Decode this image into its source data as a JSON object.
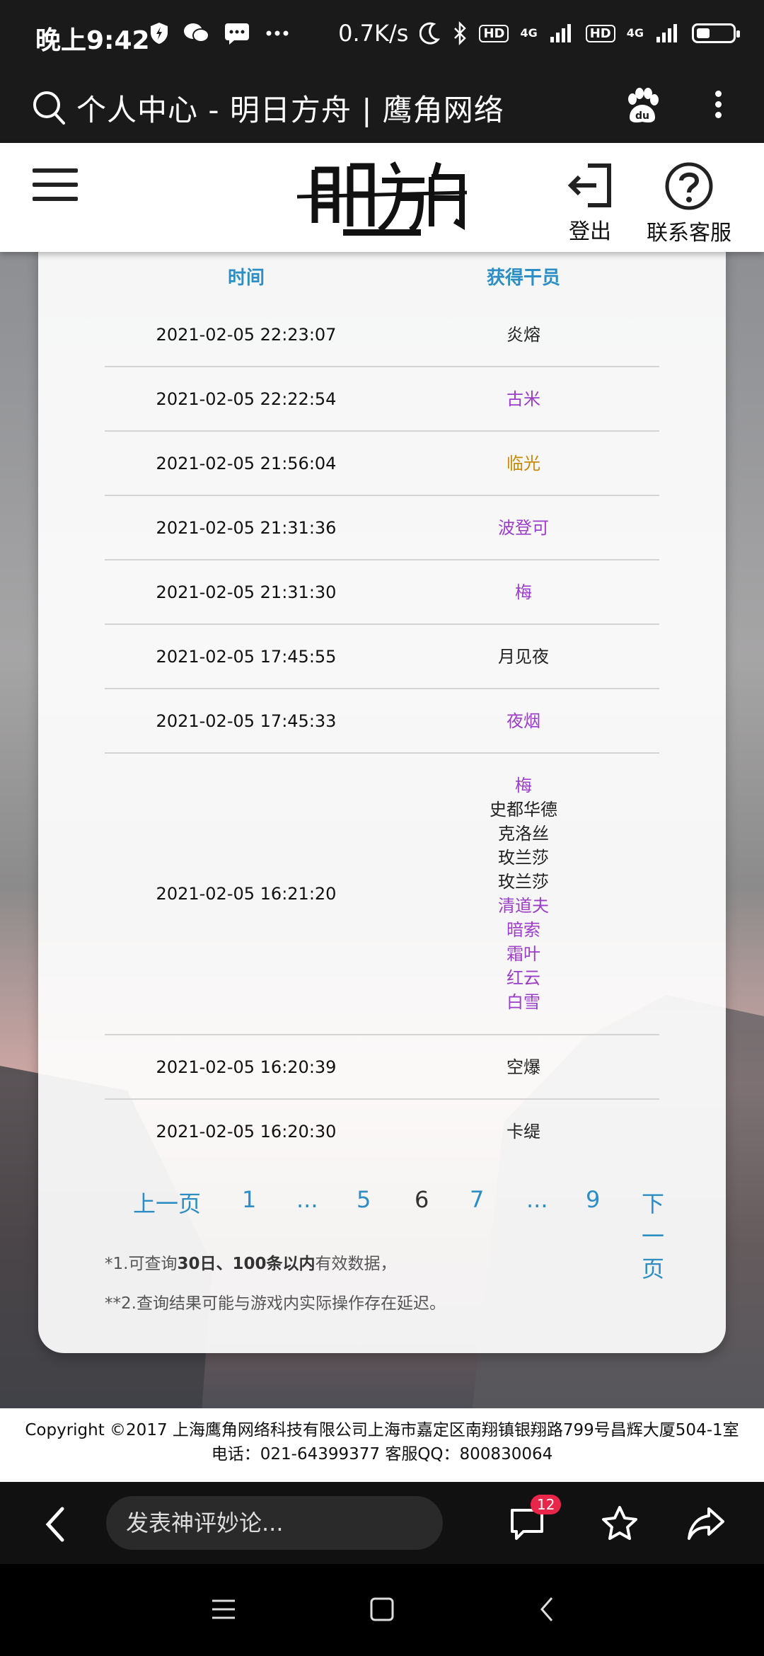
{
  "status_bar": {
    "time": "晚上9:42",
    "speed": "0.7K/s",
    "net1": "4G",
    "net2": "4G",
    "hd1": "HD",
    "hd2": "HD",
    "battery_level": 0.35
  },
  "browser": {
    "title": "个人中心 - 明日方舟 | 鹰角网络"
  },
  "header": {
    "logout_label": "登出",
    "support_label": "联系客服"
  },
  "table": {
    "col_time": "时间",
    "col_operators": "获得干员",
    "rows": [
      {
        "time": "2021-02-05 22:23:07",
        "ops": [
          {
            "name": "炎熔",
            "color": "#222222"
          }
        ]
      },
      {
        "time": "2021-02-05 22:22:54",
        "ops": [
          {
            "name": "古米",
            "color": "#9b3dc8"
          }
        ]
      },
      {
        "time": "2021-02-05 21:56:04",
        "ops": [
          {
            "name": "临光",
            "color": "#c88a0a"
          }
        ]
      },
      {
        "time": "2021-02-05 21:31:36",
        "ops": [
          {
            "name": "波登可",
            "color": "#9b3dc8"
          }
        ]
      },
      {
        "time": "2021-02-05 21:31:30",
        "ops": [
          {
            "name": "梅",
            "color": "#9b3dc8"
          }
        ]
      },
      {
        "time": "2021-02-05 17:45:55",
        "ops": [
          {
            "name": "月见夜",
            "color": "#222222"
          }
        ]
      },
      {
        "time": "2021-02-05 17:45:33",
        "ops": [
          {
            "name": "夜烟",
            "color": "#9b3dc8"
          }
        ]
      },
      {
        "time": "2021-02-05 16:21:20",
        "ops": [
          {
            "name": "梅",
            "color": "#9b3dc8"
          },
          {
            "name": "史都华德",
            "color": "#222222"
          },
          {
            "name": "克洛丝",
            "color": "#222222"
          },
          {
            "name": "玫兰莎",
            "color": "#222222"
          },
          {
            "name": "玫兰莎",
            "color": "#222222"
          },
          {
            "name": "清道夫",
            "color": "#9b3dc8"
          },
          {
            "name": "暗索",
            "color": "#9b3dc8"
          },
          {
            "name": "霜叶",
            "color": "#9b3dc8"
          },
          {
            "name": "红云",
            "color": "#9b3dc8"
          },
          {
            "name": "白雪",
            "color": "#9b3dc8"
          }
        ]
      },
      {
        "time": "2021-02-05 16:20:39",
        "ops": [
          {
            "name": "空爆",
            "color": "#222222"
          }
        ]
      },
      {
        "time": "2021-02-05 16:20:30",
        "ops": [
          {
            "name": "卡缇",
            "color": "#222222"
          }
        ]
      }
    ]
  },
  "pagination": {
    "prev": "上一页",
    "p1": "1",
    "dots1": "...",
    "p5": "5",
    "p6": "6",
    "p7": "7",
    "dots2": "...",
    "p9": "9",
    "next": "下一页"
  },
  "notes": {
    "n1_pre": "*1.可查询",
    "n1_bold": "30日、100条以内",
    "n1_post": "有效数据，",
    "n2": "**2.查询结果可能与游戏内实际操作存在延迟。"
  },
  "footer": {
    "line1": "Copyright ©2017 上海鹰角网络科技有限公司上海市嘉定区南翔镇银翔路799号昌辉大厦504-1室",
    "line2": "电话：021-64399377 客服QQ：800830064"
  },
  "bottom_bar": {
    "comment_placeholder": "发表神评妙论...",
    "comment_count": "12"
  }
}
